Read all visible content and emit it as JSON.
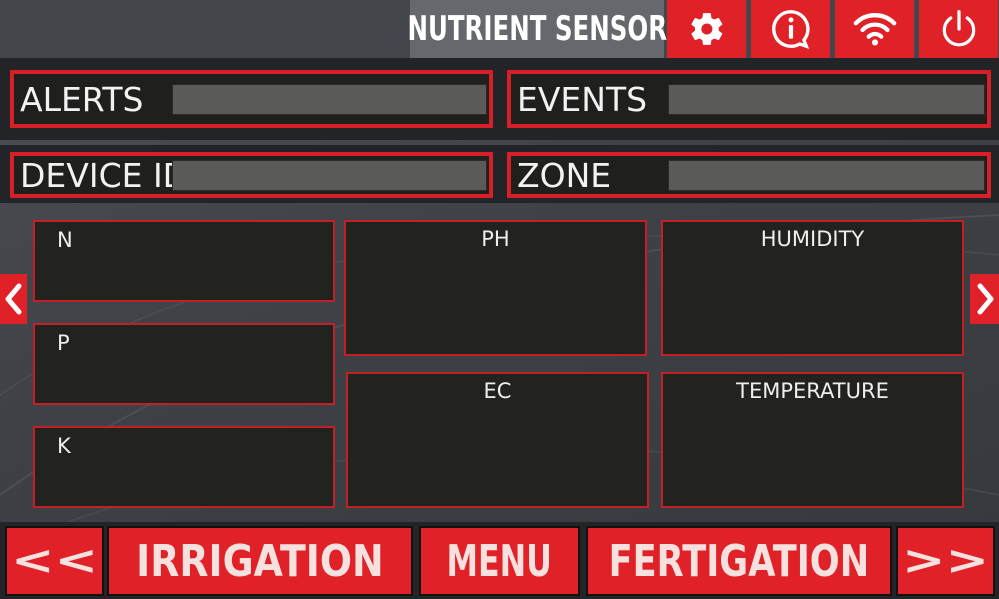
{
  "header": {
    "title": "NUTRIENT SENSOR",
    "icons": [
      "gear-icon",
      "info-icon",
      "wifi-icon",
      "power-icon"
    ]
  },
  "fields": {
    "alerts_label": "ALERTS",
    "events_label": "EVENTS",
    "device_id_label": "DEVICE ID",
    "zone_label": "ZONE"
  },
  "tiles": {
    "n": "N",
    "p": "P",
    "k": "K",
    "ph": "PH",
    "humidity": "HUMIDITY",
    "ec": "EC",
    "temperature": "TEMPERATURE"
  },
  "nav": {
    "prev_icon": "chevron-left-icon",
    "next_icon": "chevron-right-icon"
  },
  "footer": {
    "rewind_label": "<<",
    "irrigation_label": "IRRIGATION",
    "menu_label": "MENU",
    "fertigation_label": "FERTIGATION",
    "forward_label": ">>"
  },
  "colors": {
    "accent": "#e02128",
    "tile_border": "#c21f26",
    "tile_bg": "#22231f",
    "field_value": "#5a5b59"
  }
}
